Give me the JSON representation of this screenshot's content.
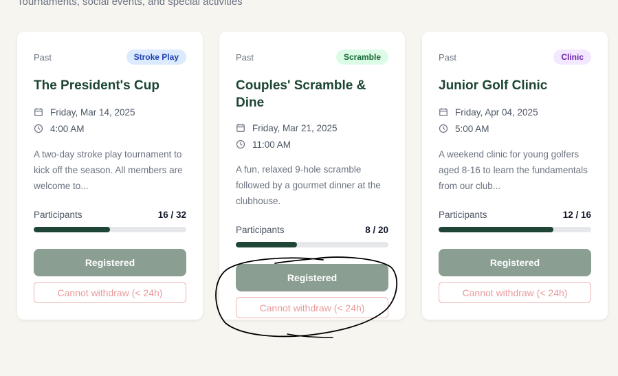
{
  "header": {
    "subtitle": "Tournaments, social events, and special activities"
  },
  "colors": {
    "title": "#1c4532",
    "progress_fill": "#1e4535",
    "registered_button": "#8a9e92",
    "withdraw_text": "#e89a9a",
    "annotation_ink": "#000000"
  },
  "events": [
    {
      "status": "Past",
      "badge": "Stroke Play",
      "badge_bg": "#dbeafe",
      "badge_color": "#1e40af",
      "title": "The President's Cup",
      "date": "Friday, Mar 14, 2025",
      "time": "4:00 AM",
      "description": "A two-day stroke play tournament to kick off the season. All members are welcome to...",
      "participants_label": "Participants",
      "participants": "16 / 32",
      "fill_percent": 50,
      "registered_label": "Registered",
      "withdraw_label": "Cannot withdraw (< 24h)"
    },
    {
      "status": "Past",
      "badge": "Scramble",
      "badge_bg": "#dcfce7",
      "badge_color": "#166534",
      "title": "Couples' Scramble & Dine",
      "date": "Friday, Mar 21, 2025",
      "time": "11:00 AM",
      "description": "A fun, relaxed 9-hole scramble followed by a gourmet dinner at the clubhouse.",
      "participants_label": "Participants",
      "participants": "8 / 20",
      "fill_percent": 40,
      "registered_label": "Registered",
      "withdraw_label": "Cannot withdraw (< 24h)"
    },
    {
      "status": "Past",
      "badge": "Clinic",
      "badge_bg": "#f3e8ff",
      "badge_color": "#6b21a8",
      "title": "Junior Golf Clinic",
      "date": "Friday, Apr 04, 2025",
      "time": "5:00 AM",
      "description": "A weekend clinic for young golfers aged 8-16 to learn the fundamentals from our club...",
      "participants_label": "Participants",
      "participants": "12 / 16",
      "fill_percent": 75,
      "registered_label": "Registered",
      "withdraw_label": "Cannot withdraw (< 24h)"
    }
  ]
}
